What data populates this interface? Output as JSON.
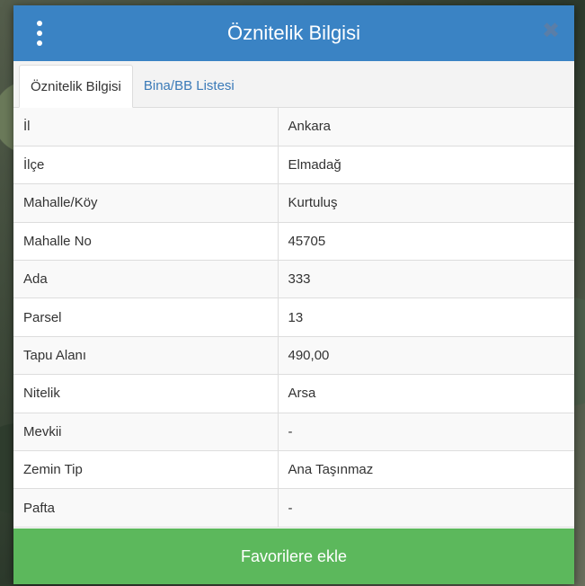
{
  "header": {
    "title": "Öznitelik Bilgisi",
    "close_glyph": "✖"
  },
  "tabs": [
    {
      "label": "Öznitelik Bilgisi",
      "active": true
    },
    {
      "label": "Bina/BB Listesi",
      "active": false
    }
  ],
  "rows": [
    {
      "key": "İl",
      "value": "Ankara"
    },
    {
      "key": "İlçe",
      "value": "Elmadağ"
    },
    {
      "key": "Mahalle/Köy",
      "value": "Kurtuluş"
    },
    {
      "key": "Mahalle No",
      "value": "45705"
    },
    {
      "key": "Ada",
      "value": "333"
    },
    {
      "key": "Parsel",
      "value": "13"
    },
    {
      "key": "Tapu Alanı",
      "value": "490,00"
    },
    {
      "key": "Nitelik",
      "value": "Arsa"
    },
    {
      "key": "Mevkii",
      "value": "-"
    },
    {
      "key": "Zemin Tip",
      "value": "Ana Taşınmaz"
    },
    {
      "key": "Pafta",
      "value": "-"
    }
  ],
  "footer": {
    "favorite_label": "Favorilere ekle"
  },
  "colors": {
    "header": "#3a83c4",
    "button": "#5cb85c",
    "tab_link": "#3a7ab8"
  }
}
